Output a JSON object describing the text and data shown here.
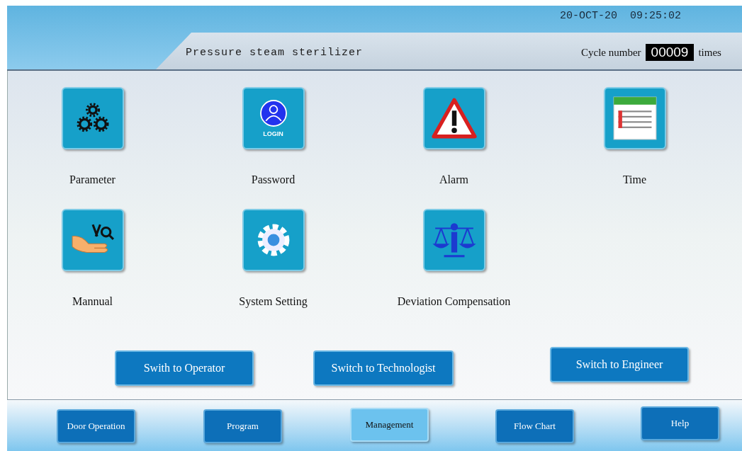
{
  "header": {
    "datetime": "20-OCT-20  09:25:02",
    "title": "Pressure steam sterilizer",
    "cycle_label": "Cycle number",
    "cycle_value": "00009",
    "cycle_unit": "times"
  },
  "menu": [
    {
      "label": "Parameter",
      "kind": "gears"
    },
    {
      "label": "Password",
      "kind": "login",
      "badge": "LOGIN"
    },
    {
      "label": "Alarm",
      "kind": "alarm"
    },
    {
      "label": "Time",
      "kind": "calendar"
    },
    {
      "label": "Mannual",
      "kind": "hand-tools"
    },
    {
      "label": "System Setting",
      "kind": "gear"
    },
    {
      "label": "Deviation Compensation",
      "kind": "scale"
    }
  ],
  "switch_buttons": [
    "Swith to Operator",
    "Switch to Technologist",
    "Switch to Engineer"
  ],
  "nav": [
    {
      "label": "Door Operation",
      "selected": false
    },
    {
      "label": "Program",
      "selected": false
    },
    {
      "label": "Management",
      "selected": true
    },
    {
      "label": "Flow Chart",
      "selected": false
    },
    {
      "label": "Help",
      "selected": false
    }
  ]
}
